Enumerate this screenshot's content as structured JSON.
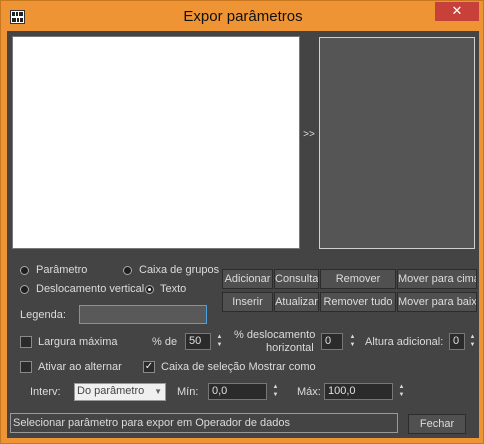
{
  "window": {
    "title": "Expor parâmetros",
    "close_glyph": "✕"
  },
  "lists": {
    "move_glyph": ">>"
  },
  "radios": {
    "parametro": "Parâmetro",
    "caixa_grupos": "Caixa de grupos",
    "deslocamento_vertical": "Deslocamento vertical",
    "texto": "Texto"
  },
  "buttons": {
    "adicionar": "Adicionar",
    "consulta": "Consulta",
    "remover": "Remover",
    "mover_cima": "Mover para cima",
    "inserir": "Inserir",
    "atualizar": "Atualizar",
    "remover_tudo": "Remover tudo",
    "mover_baixo": "Mover para baixo",
    "fechar": "Fechar"
  },
  "legend": {
    "label": "Legenda:",
    "value": ""
  },
  "options": {
    "largura_maxima": "Largura máxima",
    "pct_de_label": "% de",
    "pct_de_value": "50",
    "deslocamento_label_1": "% deslocamento",
    "deslocamento_label_2": "horizontal",
    "deslocamento_value": "0",
    "altura_label": "Altura adicional:",
    "altura_value": "0",
    "ativar_alternar": "Ativar ao alternar",
    "caixa_selecao": "Caixa de seleção Mostrar como",
    "check_glyph": "✓"
  },
  "interval": {
    "label": "Interv:",
    "selected": "Do parâmetro",
    "min_label": "Mín:",
    "min_value": "0,0",
    "max_label": "Máx:",
    "max_value": "100,0"
  },
  "status": {
    "text": "Selecionar parâmetro para expor em Operador de dados"
  },
  "spinner": {
    "up": "▲",
    "down": "▼"
  }
}
